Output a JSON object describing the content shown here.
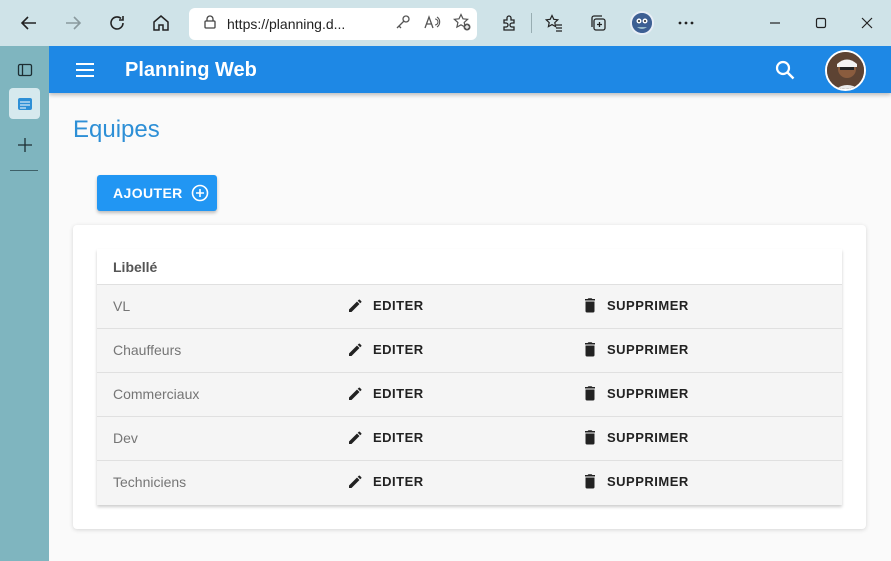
{
  "browser": {
    "url": "https://planning.d...",
    "icons": [
      "back-icon",
      "forward-icon",
      "refresh-icon",
      "home-icon",
      "lock-icon",
      "key-icon",
      "read-aloud-icon",
      "add-favorite-icon",
      "extensions-icon",
      "favorites-icon",
      "collections-icon",
      "profile-icon",
      "more-icon",
      "minimize-icon",
      "maximize-icon",
      "close-icon"
    ]
  },
  "app": {
    "title": "Planning Web",
    "primary_color": "#1e88e5"
  },
  "page": {
    "title": "Equipes",
    "add_button": "AJOUTER"
  },
  "table": {
    "header": "Libellé",
    "edit_label": "EDITER",
    "delete_label": "SUPPRIMER",
    "rows": [
      {
        "name": "VL"
      },
      {
        "name": "Chauffeurs"
      },
      {
        "name": "Commerciaux"
      },
      {
        "name": "Dev"
      },
      {
        "name": "Techniciens"
      }
    ]
  }
}
